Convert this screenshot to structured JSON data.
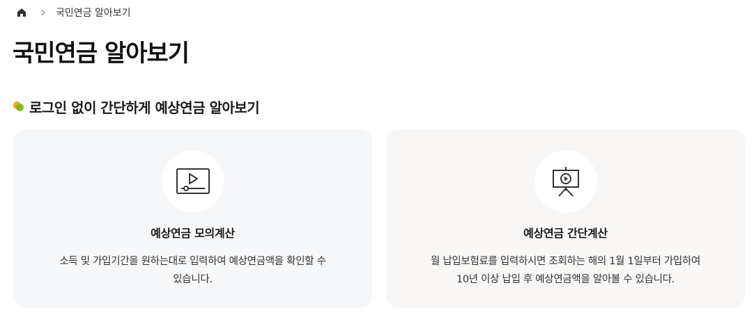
{
  "breadcrumb": {
    "home_icon": "home-icon",
    "separator_icon": "chevron-right-icon",
    "current": "국민연금 알아보기"
  },
  "page": {
    "title": "국민연금 알아보기"
  },
  "section": {
    "heading": "로그인 없이 간단하게 예상연금 알아보기",
    "bullet_colors": [
      "#f5a623",
      "#7ab317"
    ]
  },
  "cards": [
    {
      "icon": "video-player-icon",
      "title": "예상연금 모의계산",
      "desc_line1": "소득 및 가입기간을 원하는대로 입력하여 예상연금액을 확인할 수",
      "desc_line2": "있습니다."
    },
    {
      "icon": "presentation-play-icon",
      "title": "예상연금 간단계산",
      "desc_line1": "월 납입보험료를 입력하시면 조회하는 해의 1월 1일부터 가입하여",
      "desc_line2": "10년 이상 납입 후 예상연금액을 알아볼 수 있습니다."
    }
  ]
}
